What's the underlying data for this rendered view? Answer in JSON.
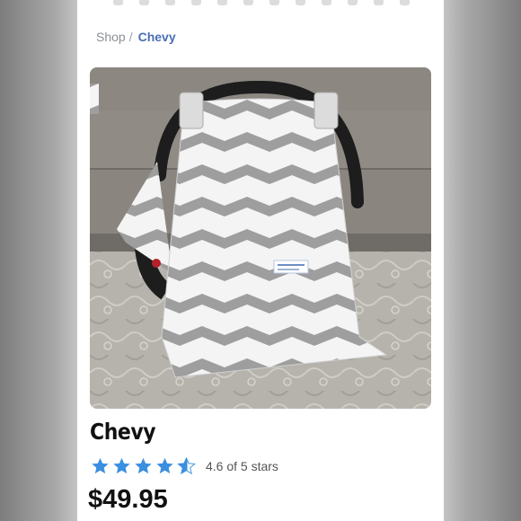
{
  "breadcrumb": {
    "shop": "Shop",
    "separator": "/",
    "current": "Chevy"
  },
  "product": {
    "title": "Chevy",
    "rating_value": 4.6,
    "rating_max": 5,
    "rating_text": "4.6 of 5 stars",
    "price": "$49.95",
    "image_alt": "Gray and white chevron car seat canopy cover"
  },
  "colors": {
    "link_accent": "#4a6fb5",
    "star_fill": "#3b8fe0",
    "chevron_gray": "#9a9a9a"
  },
  "icons": {
    "star": "star-icon"
  }
}
